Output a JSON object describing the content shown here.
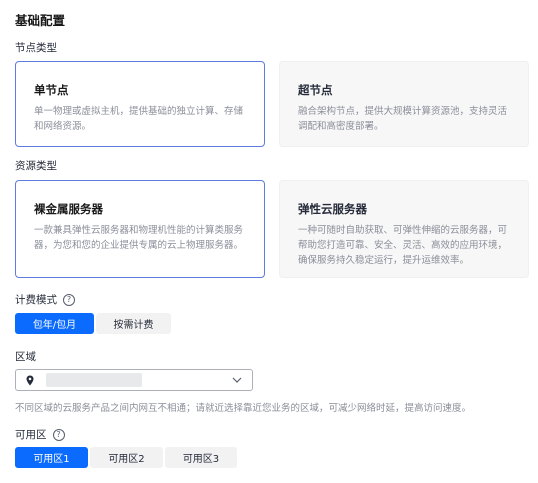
{
  "section_title": "基础配置",
  "node_type": {
    "label": "节点类型",
    "cards": [
      {
        "title": "单节点",
        "desc": "单一物理或虚拟主机，提供基础的独立计算、存储和网络资源。",
        "selected": true
      },
      {
        "title": "超节点",
        "desc": "融合架构节点，提供大规模计算资源池，支持灵活调配和高密度部署。",
        "selected": false
      }
    ]
  },
  "resource_type": {
    "label": "资源类型",
    "cards": [
      {
        "title": "裸金属服务器",
        "desc": "一款兼具弹性云服务器和物理机性能的计算类服务器，为您和您的企业提供专属的云上物理服务器。",
        "selected": true
      },
      {
        "title": "弹性云服务器",
        "desc": "一种可随时自助获取、可弹性伸缩的云服务器，可帮助您打造可靠、安全、灵活、高效的应用环境，确保服务持久稳定运行，提升运维效率。",
        "selected": false
      }
    ]
  },
  "billing": {
    "label": "计费模式",
    "options": [
      {
        "label": "包年/包月",
        "active": true
      },
      {
        "label": "按需计费",
        "active": false
      }
    ]
  },
  "region": {
    "label": "区域",
    "selected_value": "",
    "hint": "不同区域的云服务产品之间内网互不相通；请就近选择靠近您业务的区域，可减少网络时延，提高访问速度。"
  },
  "az": {
    "label": "可用区",
    "options": [
      {
        "label": "可用区1",
        "active": true
      },
      {
        "label": "可用区2",
        "active": false
      },
      {
        "label": "可用区3",
        "active": false
      }
    ]
  },
  "icons": {
    "help": "help-circle-icon",
    "location": "location-pin-icon",
    "dropdown": "chevron-down-icon"
  },
  "colors": {
    "primary": "#0b6bff",
    "selected_border": "#5e7ce0",
    "unselected_bg": "#f7f7f7",
    "muted_text": "#8a8e99"
  }
}
